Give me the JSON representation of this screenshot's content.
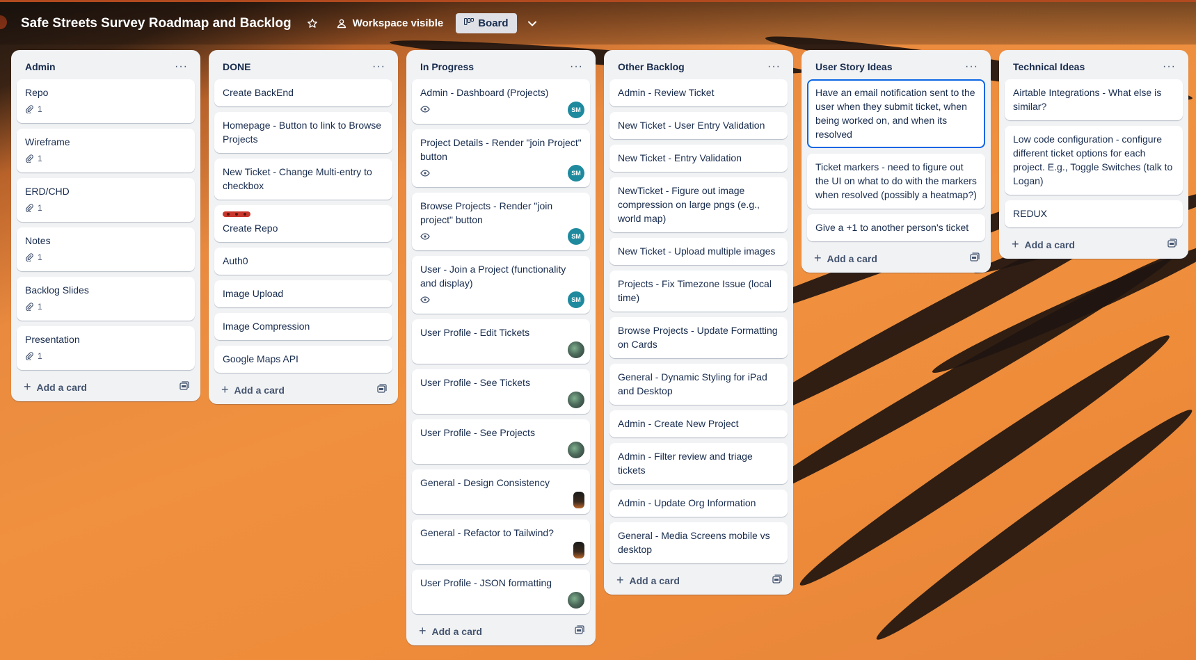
{
  "board": {
    "title": "Safe Streets Survey Roadmap and Backlog",
    "visibility_label": "Workspace visible",
    "view_label": "Board"
  },
  "lists": [
    {
      "title": "Admin",
      "add_label": "Add a card",
      "cards": [
        {
          "text": "Repo",
          "attachments": "1"
        },
        {
          "text": "Wireframe",
          "attachments": "1"
        },
        {
          "text": "ERD/CHD",
          "attachments": "1"
        },
        {
          "text": "Notes",
          "attachments": "1"
        },
        {
          "text": "Backlog Slides",
          "attachments": "1"
        },
        {
          "text": "Presentation",
          "attachments": "1"
        }
      ]
    },
    {
      "title": "DONE",
      "add_label": "Add a card",
      "cards": [
        {
          "text": "Create BackEnd"
        },
        {
          "text": "Homepage - Button to link to Browse Projects"
        },
        {
          "text": "New Ticket - Change Multi-entry to checkbox"
        },
        {
          "text": "Create Repo",
          "label_color": "#c9372c"
        },
        {
          "text": "Auth0"
        },
        {
          "text": "Image Upload"
        },
        {
          "text": "Image Compression"
        },
        {
          "text": "Google Maps API"
        }
      ]
    },
    {
      "title": "In Progress",
      "add_label": "Add a card",
      "cards": [
        {
          "text": "Admin - Dashboard (Projects)",
          "watch": true,
          "avatar": "SM"
        },
        {
          "text": "Project Details - Render \"join Project\" button",
          "watch": true,
          "avatar": "SM"
        },
        {
          "text": "Browse Projects - Render \"join project\" button",
          "watch": true,
          "avatar": "SM"
        },
        {
          "text": "User - Join a Project (functionality and display)",
          "watch": true,
          "avatar": "SM"
        },
        {
          "text": "User Profile - Edit Tickets",
          "avatar_type": "photo"
        },
        {
          "text": "User Profile - See Tickets",
          "avatar_type": "photo"
        },
        {
          "text": "User Profile - See Projects",
          "avatar_type": "photo"
        },
        {
          "text": "General - Design Consistency",
          "avatar_type": "dark"
        },
        {
          "text": "General - Refactor to Tailwind?",
          "avatar_type": "dark"
        },
        {
          "text": "User Profile - JSON formatting",
          "avatar_type": "photo"
        }
      ]
    },
    {
      "title": "Other Backlog",
      "add_label": "Add a card",
      "cards": [
        {
          "text": "Admin - Review Ticket"
        },
        {
          "text": "New Ticket - User Entry Validation"
        },
        {
          "text": "New Ticket - Entry Validation"
        },
        {
          "text": "NewTicket - Figure out image compression on large pngs (e.g., world map)"
        },
        {
          "text": "New Ticket - Upload multiple images"
        },
        {
          "text": "Projects - Fix Timezone Issue (local time)"
        },
        {
          "text": "Browse Projects - Update Formatting on Cards"
        },
        {
          "text": "General - Dynamic Styling for iPad and Desktop"
        },
        {
          "text": "Admin - Create New Project"
        },
        {
          "text": "Admin - Filter review and triage tickets"
        },
        {
          "text": "Admin - Update Org Information"
        },
        {
          "text": "General - Media Screens mobile vs desktop"
        }
      ]
    },
    {
      "title": "User Story Ideas",
      "add_label": "Add a card",
      "cards": [
        {
          "text": "Have an email notification sent to the user when they submit ticket, when being worked on, and when its resolved",
          "selected": true
        },
        {
          "text": "Ticket markers - need to figure out the UI on what to do with the markers when resolved (possibly a heatmap?)"
        },
        {
          "text": "Give a +1 to another person's ticket"
        }
      ]
    },
    {
      "title": "Technical Ideas",
      "add_label": "Add a card",
      "cards": [
        {
          "text": "Airtable Integrations - What else is similar?"
        },
        {
          "text": "Low code configuration - configure different ticket options for each project. E.g., Toggle Switches (talk to Logan)"
        },
        {
          "text": "REDUX"
        }
      ]
    }
  ],
  "colors": {
    "accent": "#0c66e4",
    "avatar_teal": "#1f8a9e",
    "label_red": "#c9372c",
    "list_bg": "#f1f2f4"
  },
  "icons": [
    "star-icon",
    "people-icon",
    "board-icon",
    "chevron-down-icon",
    "more-icon",
    "attachment-icon",
    "eye-icon",
    "plus-icon",
    "template-icon"
  ]
}
